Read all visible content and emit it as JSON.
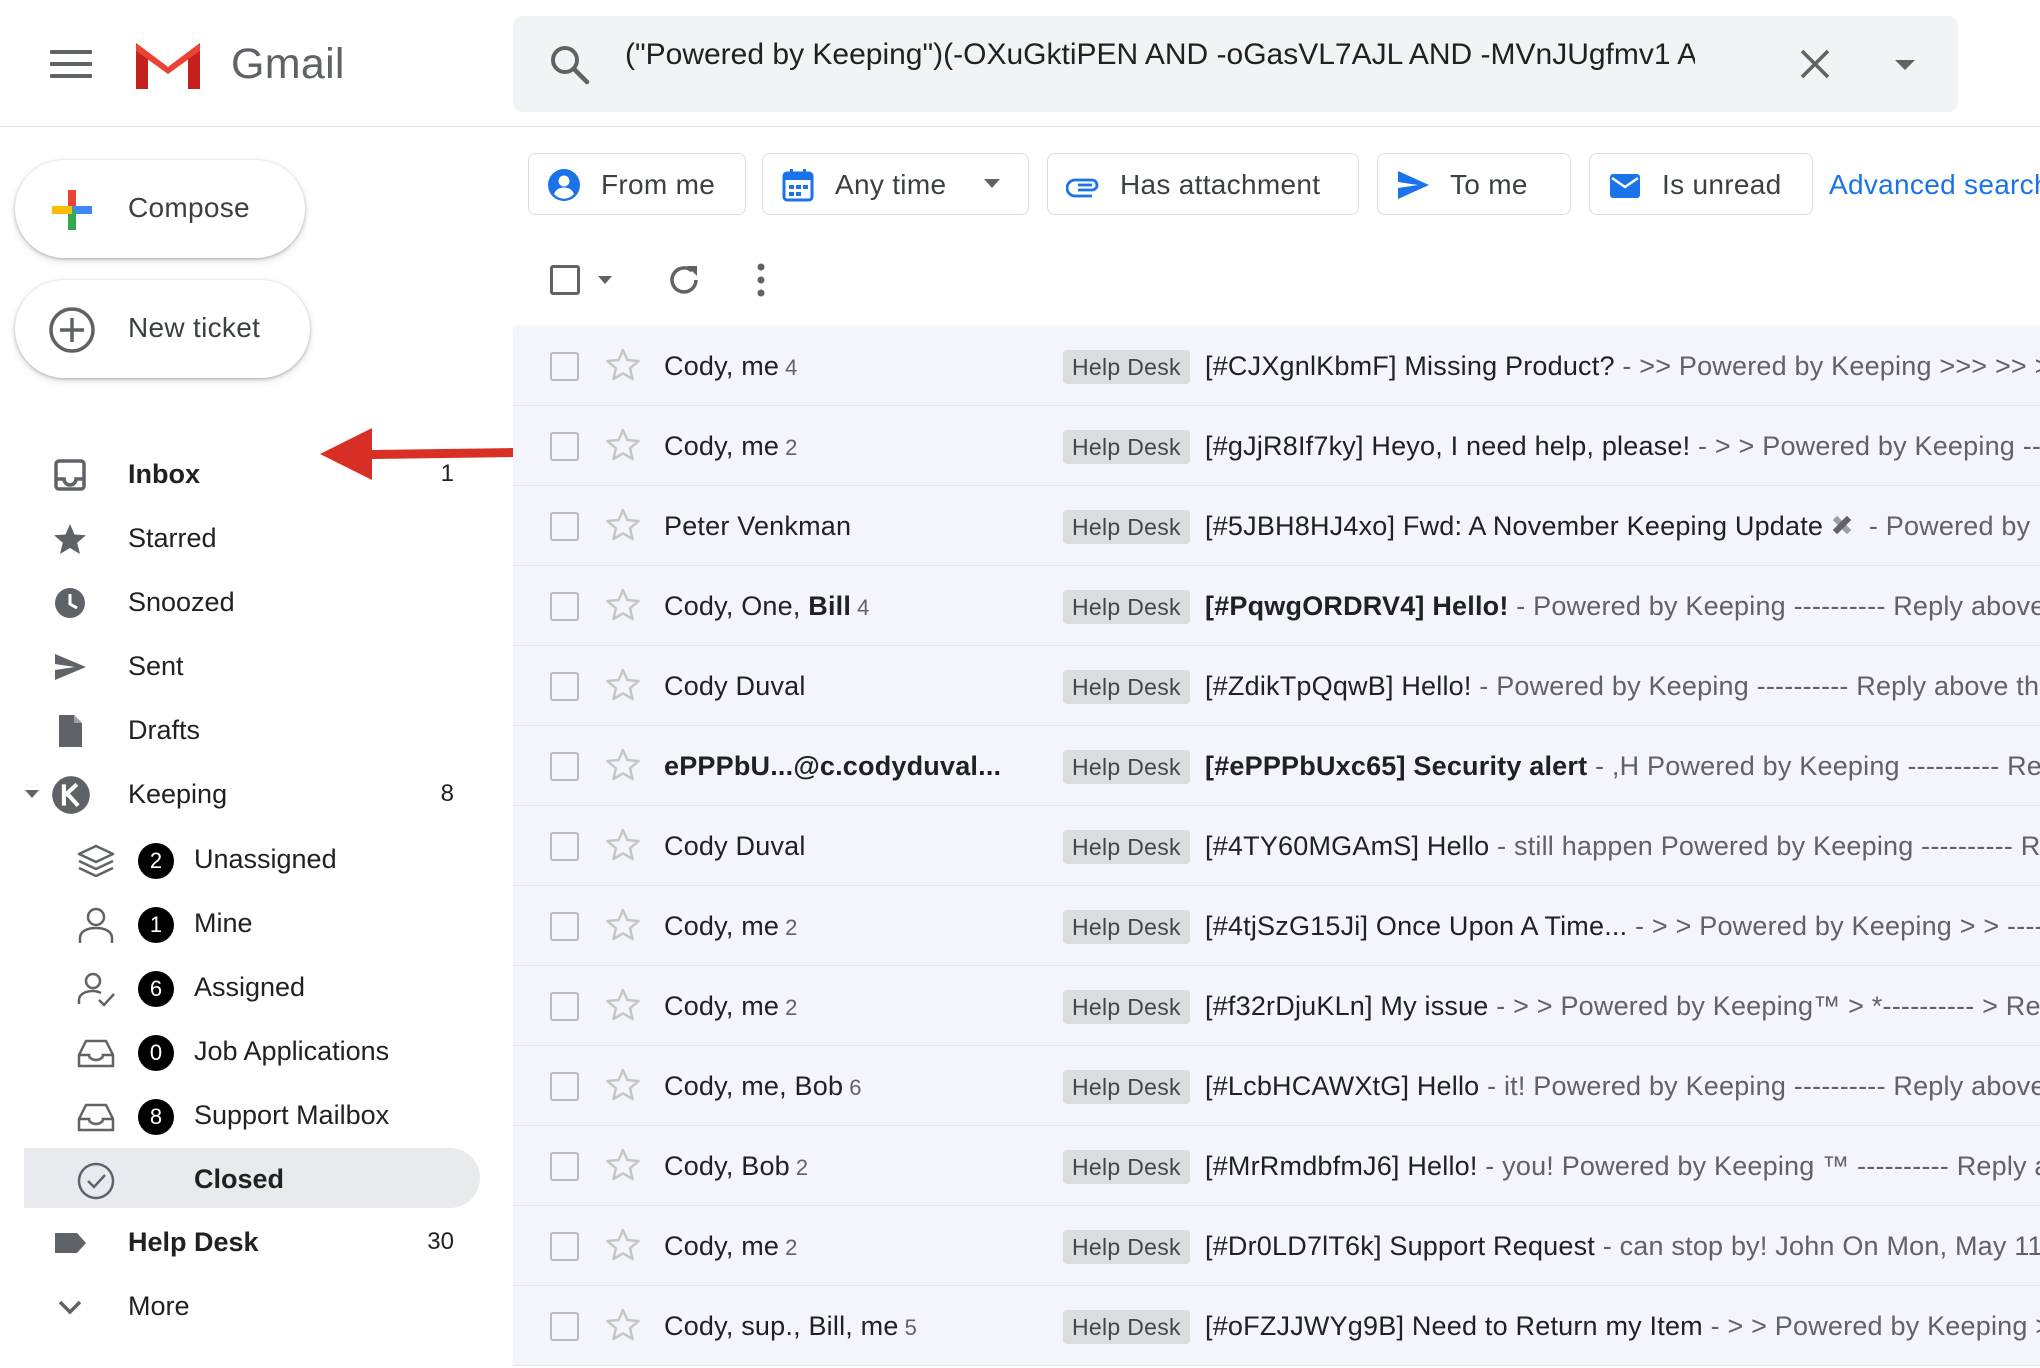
{
  "header": {
    "app_name": "Gmail",
    "search_query": "(\"Powered by Keeping\")(-OXuGktiPEN AND -oGasVL7AJL AND -MVnJUgfmv1 A"
  },
  "sidebar": {
    "compose_label": "Compose",
    "new_ticket_label": "New ticket",
    "items": [
      {
        "label": "Inbox",
        "count": "1"
      },
      {
        "label": "Starred",
        "count": ""
      },
      {
        "label": "Snoozed",
        "count": ""
      },
      {
        "label": "Sent",
        "count": ""
      },
      {
        "label": "Drafts",
        "count": ""
      },
      {
        "label": "Keeping",
        "count": "8"
      }
    ],
    "keeping_sub": [
      {
        "label": "Unassigned",
        "badge": "2"
      },
      {
        "label": "Mine",
        "badge": "1"
      },
      {
        "label": "Assigned",
        "badge": "6"
      },
      {
        "label": "Job Applications",
        "badge": "0"
      },
      {
        "label": "Support Mailbox",
        "badge": "8"
      },
      {
        "label": "Closed",
        "badge": ""
      }
    ],
    "help_desk": {
      "label": "Help Desk",
      "count": "30"
    },
    "more_label": "More"
  },
  "filters": {
    "chips": [
      "From me",
      "Any time",
      "Has attachment",
      "To me",
      "Is unread"
    ],
    "advanced_label": "Advanced search"
  },
  "emails": [
    {
      "sender": "Cody, me",
      "count": "4",
      "tag": "Help Desk",
      "subject": "[#CJXgnlKbmF] Missing Product?",
      "snippet": " - >> Powered by Keeping >>> >> >>"
    },
    {
      "sender": "Cody, me",
      "count": "2",
      "tag": "Help Desk",
      "subject": "[#gJjR8If7ky] Heyo, I need help, please!",
      "snippet": " - > > Powered by Keeping --------"
    },
    {
      "sender": "Peter Venkman",
      "count": "",
      "tag": "Help Desk",
      "subject": "[#5JBH8HJ4xo] Fwd: A November Keeping Update",
      "snippet": " - Powered by Keeping"
    },
    {
      "sender_pre": "Cody, One, ",
      "sender_bold": "Bill",
      "count": "4",
      "tag": "Help Desk",
      "subject": "[#PqwgORDRV4] Hello!",
      "snippet": " - Powered by Keeping ---------- Reply above this line"
    },
    {
      "sender": "Cody Duval",
      "count": "",
      "tag": "Help Desk",
      "subject": "[#ZdikTpQqwB] Hello!",
      "snippet": " - Powered by Keeping ---------- Reply above this line"
    },
    {
      "sender": "ePPPbU...@c.codyduval...",
      "count": "",
      "tag": "Help Desk",
      "subject": "[#ePPPbUxc65] Security alert",
      "snippet": " - ,H Powered by Keeping ---------- Reply above"
    },
    {
      "sender": "Cody Duval",
      "count": "",
      "tag": "Help Desk",
      "subject": "[#4TY60MGAmS] Hello",
      "snippet": " - still happen Powered by Keeping ---------- Reply"
    },
    {
      "sender": "Cody, me",
      "count": "2",
      "tag": "Help Desk",
      "subject": "[#4tjSzG15Ji] Once Upon A Time...",
      "snippet": " - > > Powered by Keeping > > --------"
    },
    {
      "sender": "Cody, me",
      "count": "2",
      "tag": "Help Desk",
      "subject": "[#f32rDjuKLn] My issue",
      "snippet": " - > > Powered by Keeping™ > *---------- > Reply"
    },
    {
      "sender": "Cody, me, Bob",
      "count": "6",
      "tag": "Help Desk",
      "subject": "[#LcbHCAWXtG] Hello",
      "snippet": " - it! Powered by Keeping ---------- Reply above this"
    },
    {
      "sender": "Cody, Bob",
      "count": "2",
      "tag": "Help Desk",
      "subject": "[#MrRmdbfmJ6] Hello!",
      "snippet": " - you! Powered by Keeping ™ ---------- Reply above"
    },
    {
      "sender": "Cody, me",
      "count": "2",
      "tag": "Help Desk",
      "subject": "[#Dr0LD7lT6k] Support Request",
      "snippet": " - can stop by! John On Mon, May 11"
    },
    {
      "sender": "Cody, sup., Bill, me",
      "count": "5",
      "tag": "Help Desk",
      "subject": "[#oFZJJWYg9B] Need to Return my Item",
      "snippet": " - > > Powered by Keeping > >"
    }
  ],
  "colors": {
    "accent_blue": "#1a73e8",
    "arrow_red": "#d93025",
    "row_bg": "#f2f6fc"
  }
}
